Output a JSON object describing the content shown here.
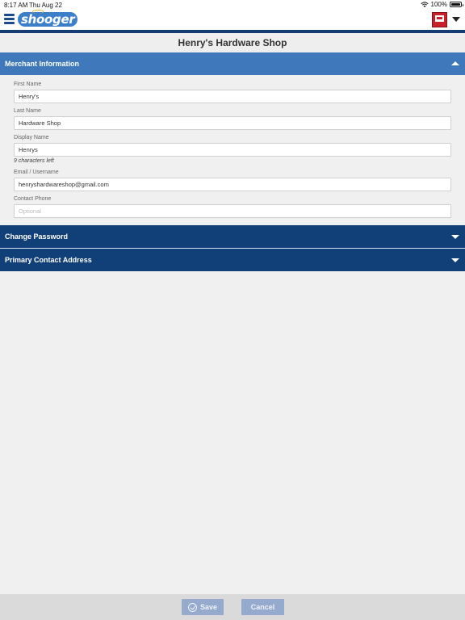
{
  "status_bar": {
    "time": "8:17 AM",
    "date": "Thu Aug 22",
    "battery": "100%"
  },
  "app": {
    "logo_text": "shooger",
    "brand_color": "#163d73",
    "accent_color": "#3f79bc"
  },
  "page": {
    "title": "Henry's Hardware Shop"
  },
  "sections": {
    "merchant_info": {
      "label": "Merchant Information",
      "state": "expanded"
    },
    "change_password": {
      "label": "Change Password",
      "state": "collapsed"
    },
    "primary_contact": {
      "label": "Primary Contact Address",
      "state": "collapsed"
    }
  },
  "form": {
    "first_name": {
      "label": "First Name",
      "value": "Henry's"
    },
    "last_name": {
      "label": "Last Name",
      "value": "Hardware Shop"
    },
    "display_name": {
      "label": "Display Name",
      "value": "Henrys",
      "hint": "9 characters left"
    },
    "email": {
      "label": "Email / Username",
      "value": "henryshardwareshop@gmail.com"
    },
    "phone": {
      "label": "Contact Phone",
      "value": "",
      "placeholder": "Optional"
    }
  },
  "footer": {
    "save_label": "Save",
    "cancel_label": "Cancel"
  },
  "icons": {
    "menu": "hamburger-icon",
    "account_dropdown": "chevron-down-icon",
    "wifi": "wifi-icon",
    "battery": "battery-icon",
    "save": "check-circle-icon"
  }
}
